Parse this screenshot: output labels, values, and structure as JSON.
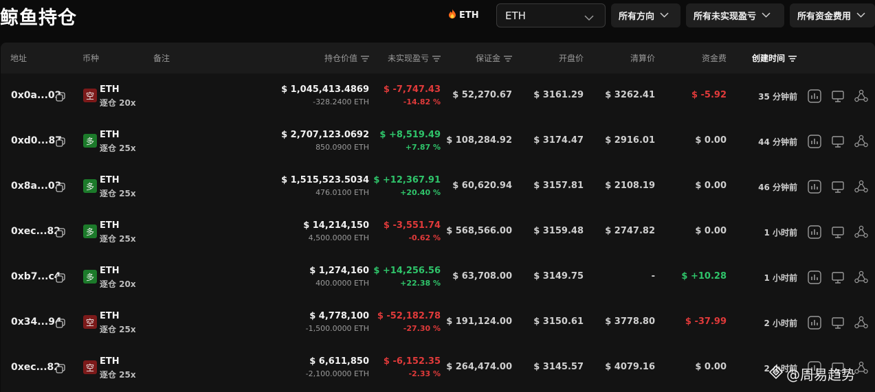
{
  "page": {
    "title": "鲸鱼持仓"
  },
  "toolbar": {
    "coin_chip": "ETH",
    "coin_select": "ETH",
    "filter_direction": "所有方向",
    "filter_pnl": "所有未实现盈亏",
    "filter_funding": "所有资金费用"
  },
  "columns": {
    "address": "地址",
    "coin": "币种",
    "note": "备注",
    "position_value": "持仓价值",
    "unrealized_pnl": "未实现盈亏",
    "margin": "保证金",
    "open_price": "开盘价",
    "liq_price": "清算价",
    "funding": "资金费",
    "created": "创建时间"
  },
  "rows": [
    {
      "address": "0x0a...02",
      "side": "空",
      "side_type": "short",
      "coin": "ETH",
      "leverage": "逐仓 20x",
      "value": "$ 1,045,413.4869",
      "size": "-328.2400 ETH",
      "pnl": "$ -7,747.43",
      "pnl_pct": "-14.82 %",
      "pnl_dir": "red",
      "margin": "$ 52,270.67",
      "open": "$ 3161.29",
      "liq": "$ 3262.41",
      "funding": "$ -5.92",
      "funding_dir": "red",
      "time": "35 分钟前"
    },
    {
      "address": "0xd0...87",
      "side": "多",
      "side_type": "long",
      "coin": "ETH",
      "leverage": "逐仓 25x",
      "value": "$ 2,707,123.0692",
      "size": "850.0900 ETH",
      "pnl": "$ +8,519.49",
      "pnl_pct": "+7.87 %",
      "pnl_dir": "green",
      "margin": "$ 108,284.92",
      "open": "$ 3174.47",
      "liq": "$ 2916.01",
      "funding": "$ 0.00",
      "funding_dir": "neutral",
      "time": "44 分钟前"
    },
    {
      "address": "0x8a...03",
      "side": "多",
      "side_type": "long",
      "coin": "ETH",
      "leverage": "逐仓 25x",
      "value": "$ 1,515,523.5034",
      "size": "476.0100 ETH",
      "pnl": "$ +12,367.91",
      "pnl_pct": "+20.40 %",
      "pnl_dir": "green",
      "margin": "$ 60,620.94",
      "open": "$ 3157.81",
      "liq": "$ 2108.19",
      "funding": "$ 0.00",
      "funding_dir": "neutral",
      "time": "46 分钟前"
    },
    {
      "address": "0xec...82",
      "side": "多",
      "side_type": "long",
      "coin": "ETH",
      "leverage": "逐仓 25x",
      "value": "$ 14,214,150",
      "size": "4,500.0000 ETH",
      "pnl": "$ -3,551.74",
      "pnl_pct": "-0.62 %",
      "pnl_dir": "red",
      "margin": "$ 568,566.00",
      "open": "$ 3159.48",
      "liq": "$ 2747.82",
      "funding": "$ 0.00",
      "funding_dir": "neutral",
      "time": "1 小时前"
    },
    {
      "address": "0xb7...c4",
      "side": "多",
      "side_type": "long",
      "coin": "ETH",
      "leverage": "逐仓 20x",
      "value": "$ 1,274,160",
      "size": "400.0000 ETH",
      "pnl": "$ +14,256.56",
      "pnl_pct": "+22.38 %",
      "pnl_dir": "green",
      "margin": "$ 63,708.00",
      "open": "$ 3149.75",
      "liq": "-",
      "funding": "$ +10.28",
      "funding_dir": "green",
      "time": "1 小时前"
    },
    {
      "address": "0x34...94",
      "side": "空",
      "side_type": "short",
      "coin": "ETH",
      "leverage": "逐仓 25x",
      "value": "$ 4,778,100",
      "size": "-1,500.0000 ETH",
      "pnl": "$ -52,182.78",
      "pnl_pct": "-27.30 %",
      "pnl_dir": "red",
      "margin": "$ 191,124.00",
      "open": "$ 3150.61",
      "liq": "$ 3778.80",
      "funding": "$ -37.99",
      "funding_dir": "red",
      "time": "2 小时前"
    },
    {
      "address": "0xec...82",
      "side": "空",
      "side_type": "short",
      "coin": "ETH",
      "leverage": "逐仓 25x",
      "value": "$ 6,611,850",
      "size": "-2,100.0000 ETH",
      "pnl": "$ -6,152.35",
      "pnl_pct": "-2.33 %",
      "pnl_dir": "red",
      "margin": "$ 264,474.00",
      "open": "$ 3145.57",
      "liq": "$ 4079.16",
      "funding": "$ 0.00",
      "funding_dir": "neutral",
      "time": "2 小时前"
    }
  ],
  "icons": {
    "fire": "fire-icon",
    "chevron": "chevron-down-icon",
    "sort": "sort-icon",
    "copy": "copy-icon",
    "chart": "chart-icon",
    "monitor": "monitor-icon",
    "share": "share-icon"
  },
  "watermark": "@周易趋势",
  "colors": {
    "red": "#e03a3a",
    "green": "#2fc46a",
    "short_badge": "#7c1a1a",
    "long_badge": "#1c7a2a"
  }
}
